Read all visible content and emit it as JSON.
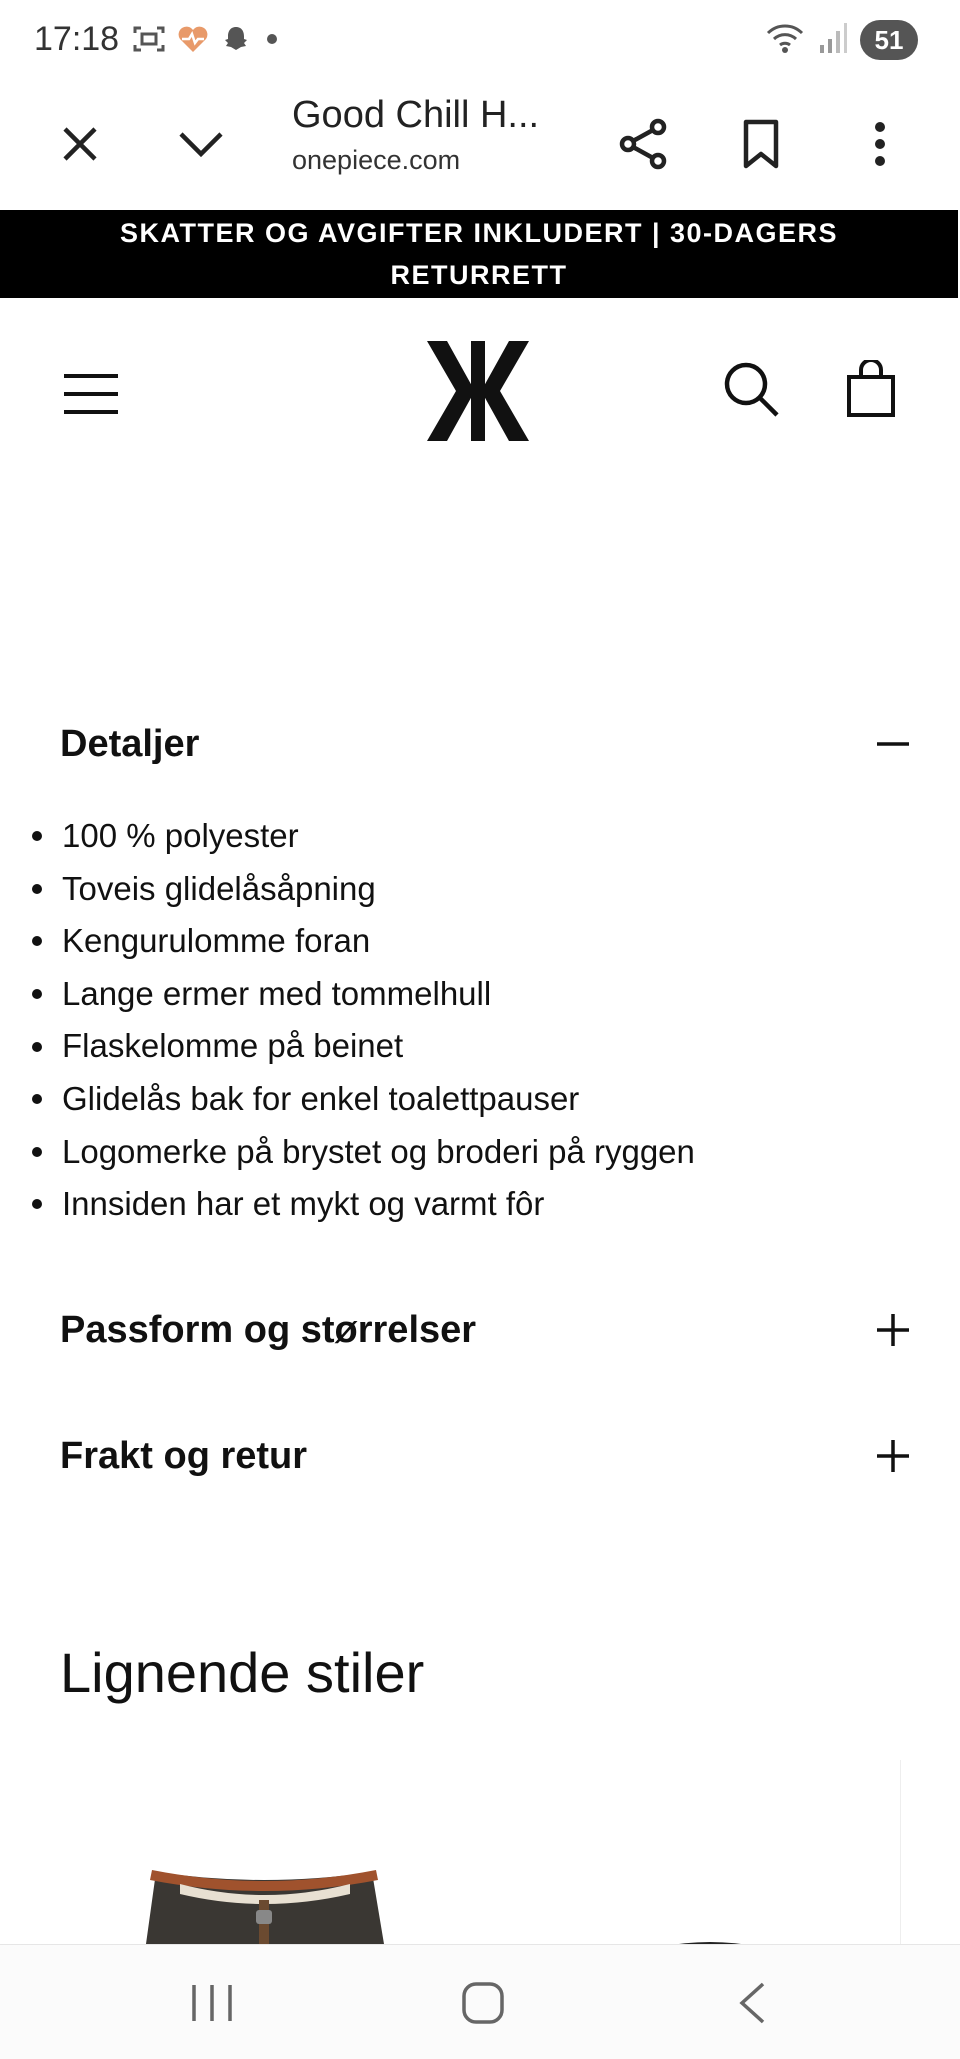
{
  "status_bar": {
    "time": "17:18",
    "battery": "51",
    "icons_left": [
      "screenshot-icon",
      "health-icon",
      "snapchat-icon",
      "dot-icon"
    ],
    "icons_right": [
      "wifi-icon",
      "signal-icon"
    ]
  },
  "browser": {
    "title": "Good Chill H...",
    "url": "onepiece.com",
    "buttons": [
      "close-icon",
      "chevron-down-icon",
      "share-icon",
      "bookmark-icon",
      "more-icon"
    ]
  },
  "promo": {
    "line1": "SKATTER OG AVGIFTER INKLUDERT | 30-DAGERS",
    "line2": "RETURRETT"
  },
  "header": {
    "icons": [
      "menu-icon",
      "onepiece-logo",
      "search-icon",
      "bag-icon"
    ]
  },
  "details": {
    "title": "Detaljer",
    "toggle": "−",
    "items": [
      "100 % polyester",
      "Toveis glidelåsåpning",
      "Kengurulomme foran",
      "Lange ermer med tommelhull",
      "Flaskelomme på beinet",
      "Glidelås bak for enkel toalettpauser",
      "Logomerke på brystet og broderi på ryggen",
      "Innsiden har et mykt og varmt fôr"
    ]
  },
  "fit": {
    "title": "Passform og størrelser",
    "toggle": "+"
  },
  "shipping": {
    "title": "Frakt og retur",
    "toggle": "+"
  },
  "similar": {
    "title": "Lignende stiler"
  },
  "colors": {
    "promo_bg": "#000000",
    "text": "#111111",
    "product_trim": "#a0522d",
    "product_body": "#3a3733"
  }
}
